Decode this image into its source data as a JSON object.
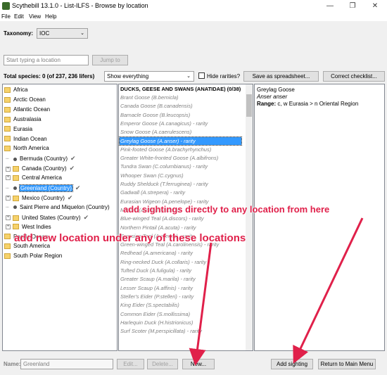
{
  "window": {
    "title": "Scythebill 13.1.0 - List-ILFS - Browse by location",
    "minimize": "—",
    "maximize": "❐",
    "close": "✕"
  },
  "menu": {
    "file": "File",
    "edit": "Edit",
    "view": "View",
    "help": "Help"
  },
  "taxonomy": {
    "label": "Taxonomy:",
    "value": "IOC"
  },
  "location_search": {
    "placeholder": "Start typing a location",
    "jump_label": "Jump to"
  },
  "toolbar": {
    "total_species": "Total species: 0 (of 237, 236 lifers)",
    "filter_value": "Show everything",
    "hide_rarities_label": "Hide rarities?",
    "save_spreadsheet": "Save as spreadsheet...",
    "correct_checklist": "Correct checklist..."
  },
  "locations": [
    {
      "label": "Africa",
      "kind": "folder",
      "depth": 0
    },
    {
      "label": "Arctic Ocean",
      "kind": "folder",
      "depth": 0
    },
    {
      "label": "Atlantic Ocean",
      "kind": "folder",
      "depth": 0
    },
    {
      "label": "Australasia",
      "kind": "folder",
      "depth": 0
    },
    {
      "label": "Eurasia",
      "kind": "folder",
      "depth": 0
    },
    {
      "label": "Indian Ocean",
      "kind": "folder",
      "depth": 0
    },
    {
      "label": "North America",
      "kind": "open",
      "depth": 0
    },
    {
      "label": "Bermuda (Country)",
      "kind": "leaf",
      "depth": 1,
      "check": true
    },
    {
      "label": "Canada (Country)",
      "kind": "expand",
      "depth": 1,
      "check": true
    },
    {
      "label": "Central America",
      "kind": "expand",
      "depth": 1
    },
    {
      "label": "Greenland (Country)",
      "kind": "leaf",
      "depth": 1,
      "check": true,
      "selected": true
    },
    {
      "label": "Mexico (Country)",
      "kind": "expand",
      "depth": 1,
      "check": true
    },
    {
      "label": "Saint Pierre and Miquelon (Country)",
      "kind": "leaf",
      "depth": 1
    },
    {
      "label": "United States (Country)",
      "kind": "expand",
      "depth": 1,
      "check": true
    },
    {
      "label": "West Indies",
      "kind": "expand",
      "depth": 1
    },
    {
      "label": "Pacific Ocean",
      "kind": "folder",
      "depth": 0
    },
    {
      "label": "South America",
      "kind": "folder",
      "depth": 0
    },
    {
      "label": "South Polar Region",
      "kind": "folder",
      "depth": 0
    }
  ],
  "species_header": "DUCKS, GEESE AND SWANS (ANATIDAE) (0/38)",
  "species": [
    "Brant Goose (B.bernicla)",
    "Canada Goose (B.canadensis)",
    "Barnacle Goose (B.leucopsis)",
    "Emperor Goose (A.canagicus) - rarity",
    "Snow Goose (A.caerulescens)",
    "Greylag Goose (A.anser) - rarity",
    "Pink-footed Goose (A.brachyrhynchus)",
    "Greater White-fronted Goose (A.albifrons)",
    "Tundra Swan (C.columbianus) - rarity",
    "Whooper Swan (C.cygnus)",
    "Ruddy Shelduck (T.ferruginea) - rarity",
    "Gadwall (A.strepera) - rarity",
    "Eurasian Wigeon (A.penelope) - rarity",
    "Mallard (A.platyrhynchos)",
    "Blue-winged Teal (A.discors) - rarity",
    "Northern Pintail (A.acuta) - rarity",
    "Eurasian Teal (A.crecca) - rarity",
    "Green-winged Teal (A.carolinensis) - rarity",
    "Redhead (A.americana) - rarity",
    "Ring-necked Duck (A.collaris) - rarity",
    "Tufted Duck (A.fuligula) - rarity",
    "Greater Scaup (A.marila) - rarity",
    "Lesser Scaup (A.affinis) - rarity",
    "Steller's Eider (P.stelleri) - rarity",
    "King Eider (S.spectabilis)",
    "Common Eider (S.mollissima)",
    "Harlequin Duck (H.histrionicus)",
    "Surf Scoter (M.perspicillata) - rarity"
  ],
  "selected_species_index": 5,
  "detail": {
    "name": "Greylag Goose",
    "latin": "Anser anser",
    "range_label": "Range:",
    "range_value": " c, w Eurasia > n Oriental Region"
  },
  "bottom": {
    "name_label": "Name:",
    "name_value": "Greenland",
    "edit": "Edit...",
    "delete": "Delete...",
    "new": "New...",
    "add_sighting": "Add sighting",
    "return_main": "Return to Main Menu"
  },
  "annotations": {
    "add_sightings": "add sightings directly to any location from here",
    "add_location": "add new location under any of these locations"
  },
  "colors": {
    "annotation": "#e0204a",
    "selection": "#3399ff"
  }
}
